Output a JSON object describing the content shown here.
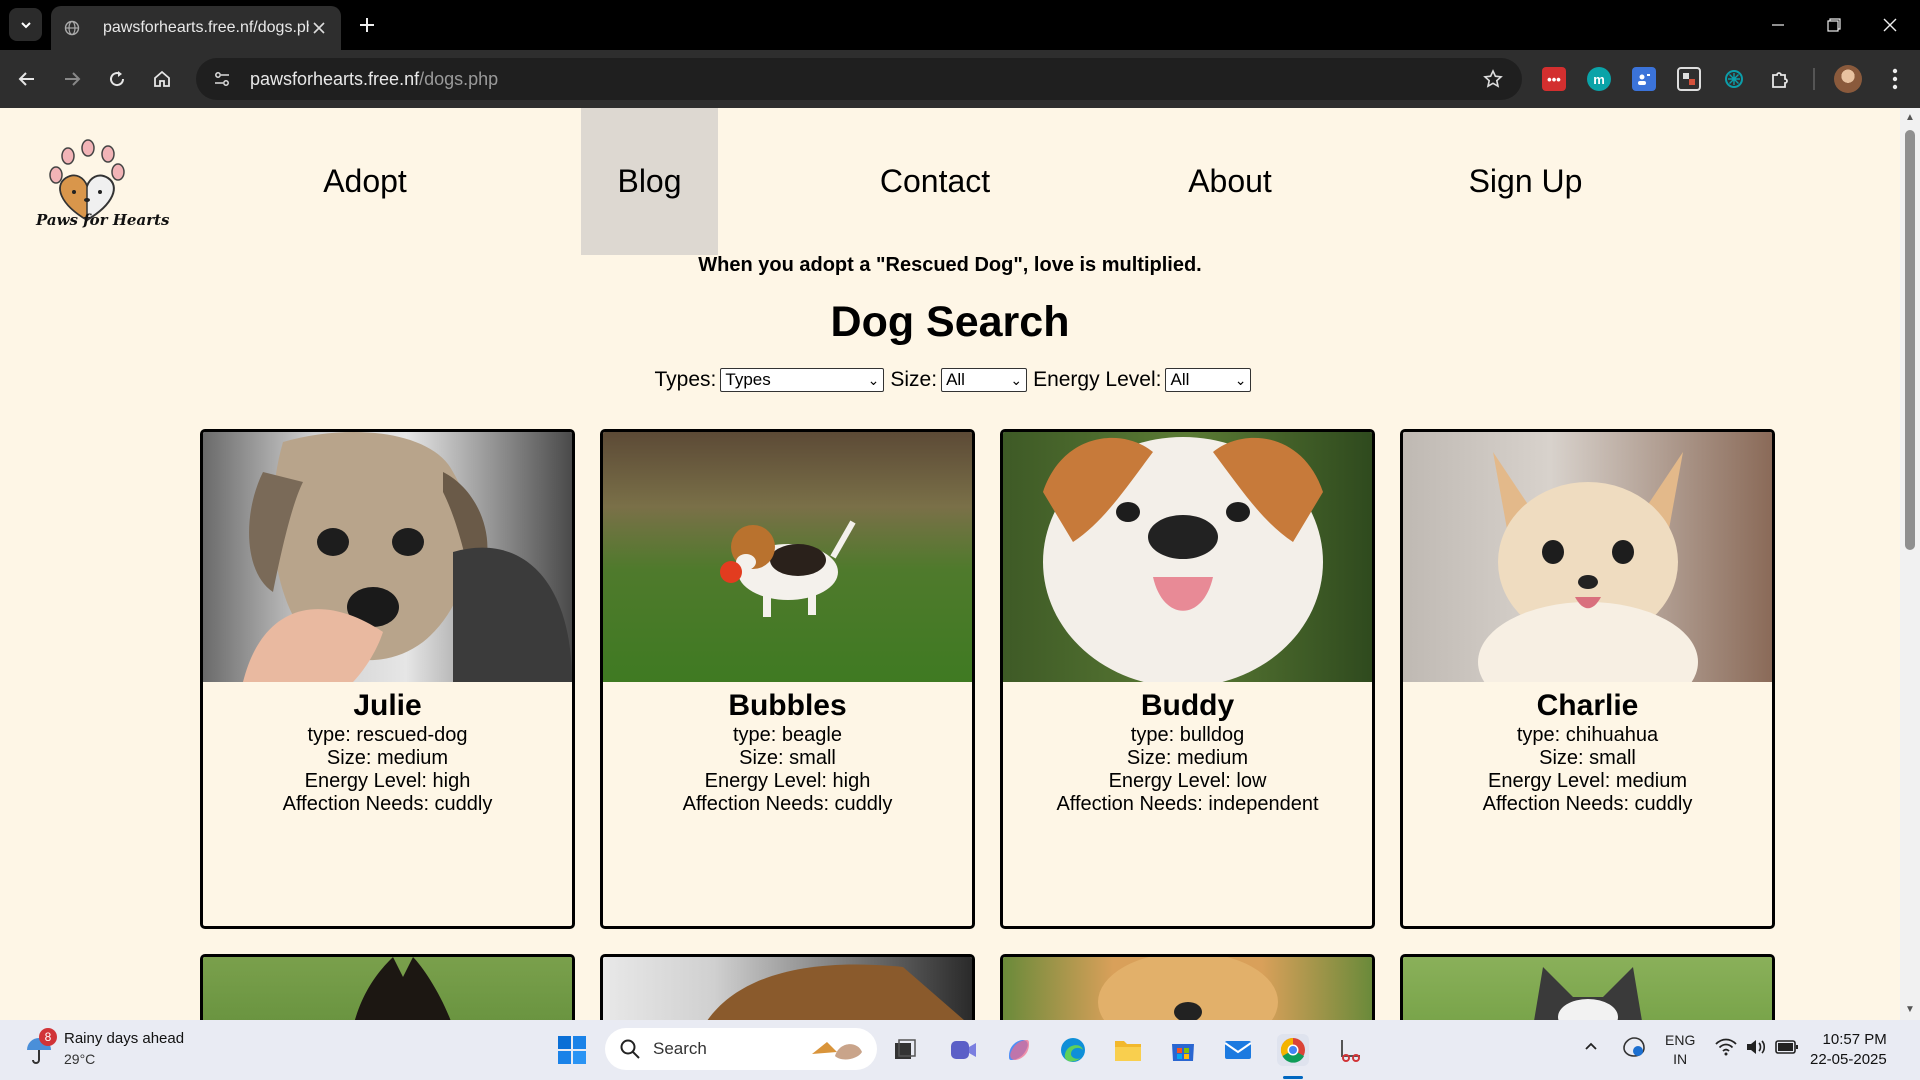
{
  "browser": {
    "tab_title": "pawsforhearts.free.nf/dogs.php",
    "url_domain": "pawsforhearts.free.nf",
    "url_path": "/dogs.php"
  },
  "site": {
    "logo_text": "Paws for Hearts",
    "nav": [
      {
        "label": "Adopt",
        "active": false
      },
      {
        "label": "Blog",
        "active": true
      },
      {
        "label": "Contact",
        "active": false
      },
      {
        "label": "About",
        "active": false
      },
      {
        "label": "Sign Up",
        "active": false
      }
    ],
    "tagline": "When you adopt a \"Rescued Dog\", love is multiplied.",
    "heading": "Dog Search",
    "filters": {
      "types_label": "Types:",
      "types_value": "Types",
      "size_label": "Size:",
      "size_value": "All",
      "energy_label": "Energy Level:",
      "energy_value": "All"
    },
    "dogs": [
      {
        "name": "Julie",
        "type": "type: rescued-dog",
        "size": "Size: medium",
        "energy": "Energy Level: high",
        "affection": "Affection Needs: cuddly"
      },
      {
        "name": "Bubbles",
        "type": "type: beagle",
        "size": "Size: small",
        "energy": "Energy Level: high",
        "affection": "Affection Needs: cuddly"
      },
      {
        "name": "Buddy",
        "type": "type: bulldog",
        "size": "Size: medium",
        "energy": "Energy Level: low",
        "affection": "Affection Needs: independent"
      },
      {
        "name": "Charlie",
        "type": "type: chihuahua",
        "size": "Size: small",
        "energy": "Energy Level: medium",
        "affection": "Affection Needs: cuddly"
      }
    ]
  },
  "taskbar": {
    "weather_title": "Rainy days ahead",
    "weather_temp": "29°C",
    "weather_badge": "8",
    "search_placeholder": "Search",
    "lang_line1": "ENG",
    "lang_line2": "IN",
    "time": "10:57 PM",
    "date": "22-05-2025"
  }
}
